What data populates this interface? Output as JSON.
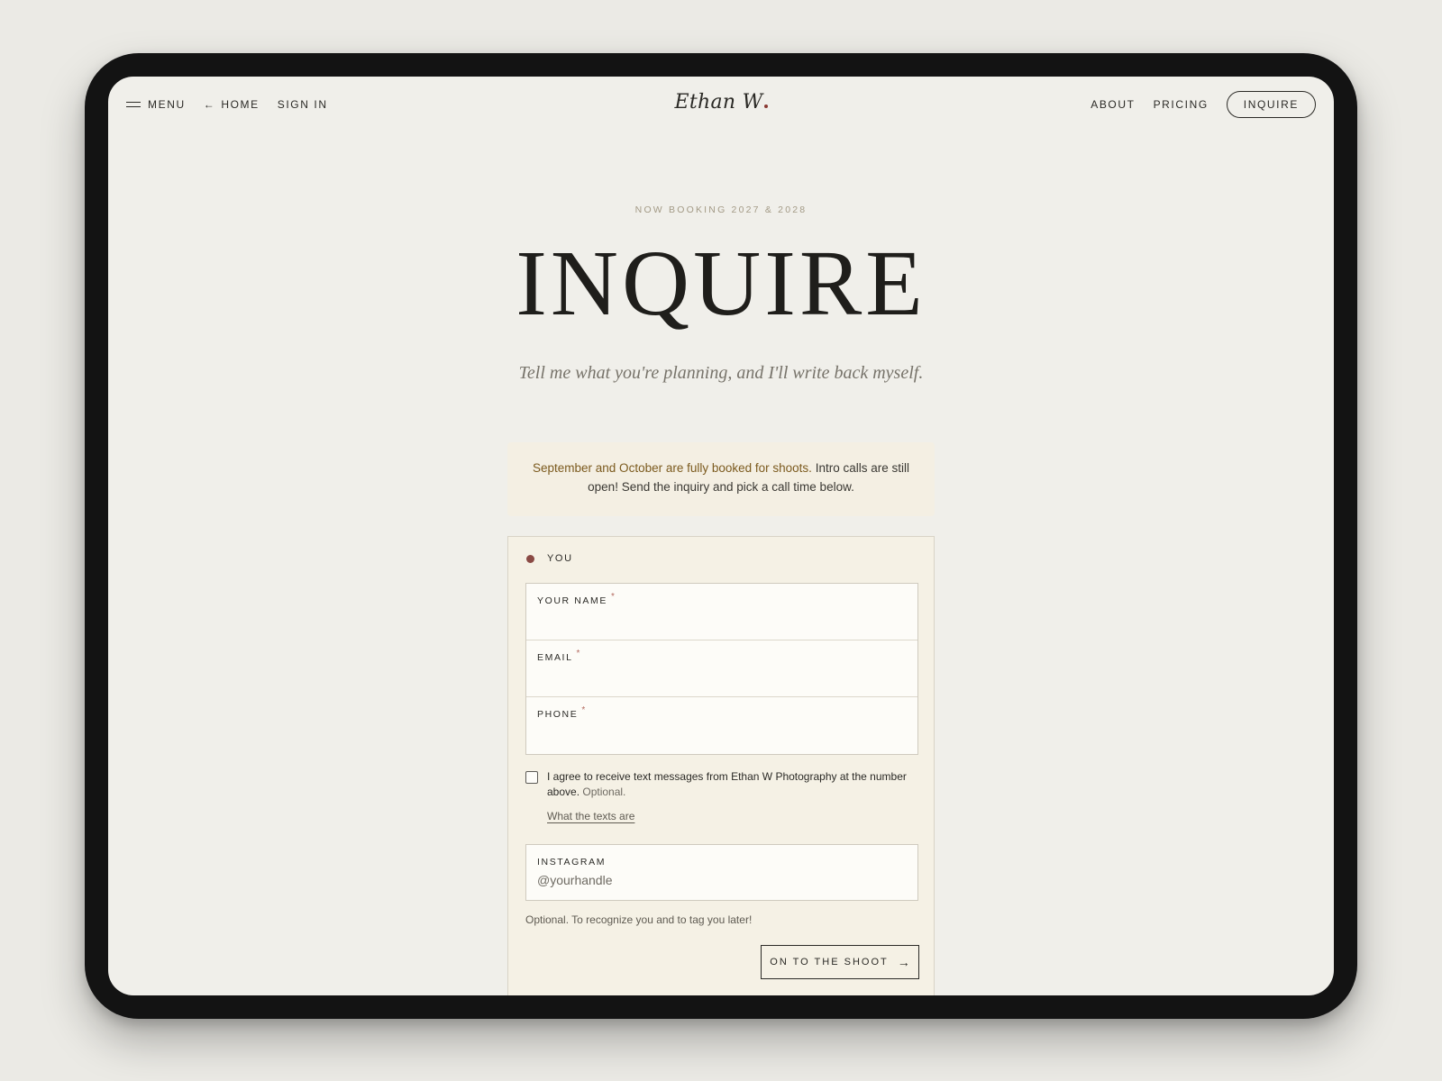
{
  "nav": {
    "menu_label": "MENU",
    "home_label": "HOME",
    "signin_label": "SIGN IN",
    "logo_text": "Ethan W",
    "about_label": "ABOUT",
    "pricing_label": "PRICING",
    "inquire_label": "INQUIRE"
  },
  "hero": {
    "eyebrow": "NOW BOOKING 2027 & 2028",
    "title": "INQUIRE",
    "subtitle": "Tell me what you're planning, and I'll write back myself."
  },
  "notice": {
    "highlight": "September and October are fully booked for shoots.",
    "rest": " Intro calls are still open! Send the inquiry and pick a call time below."
  },
  "form": {
    "step_label": "YOU",
    "fields": [
      {
        "label": "YOUR NAME",
        "required_mark": "*",
        "value": ""
      },
      {
        "label": "EMAIL",
        "required_mark": "*",
        "value": ""
      },
      {
        "label": "PHONE",
        "required_mark": "*",
        "value": ""
      }
    ],
    "consent": {
      "text": "I agree to receive text messages from Ethan W Photography at the number above.",
      "optional": " Optional.",
      "checked": false,
      "link": "What the texts are"
    },
    "instagram": {
      "label": "INSTAGRAM",
      "placeholder": "@yourhandle",
      "hint": "Optional. To recognize you and to tag you later!"
    },
    "submit_label": "ON TO THE SHOOT",
    "submit_icon": "arrow-right-icon"
  },
  "colors": {
    "background": "#f0efea",
    "accent_dot": "#8a4a44",
    "notice_highlight": "#7b5a1e",
    "card_bg": "#f5f1e5"
  }
}
